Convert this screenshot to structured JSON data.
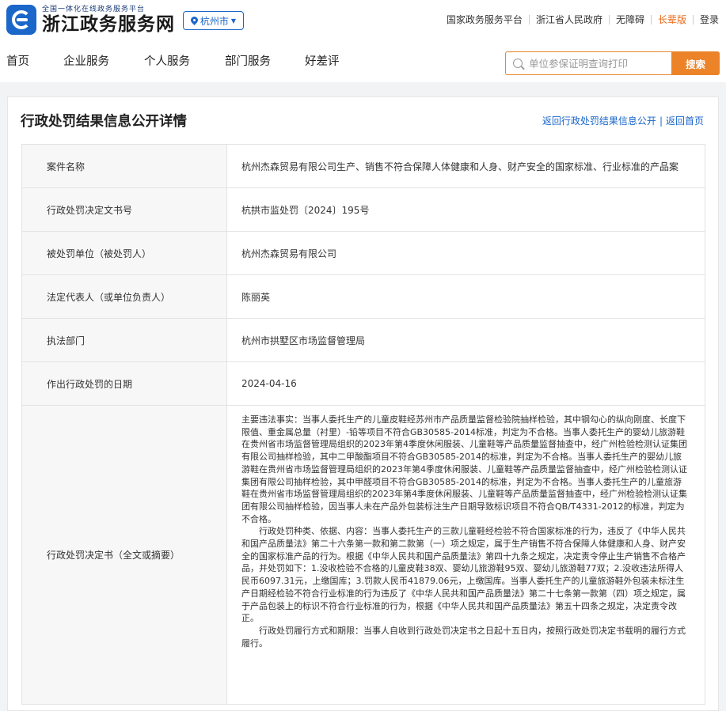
{
  "header": {
    "logo_sub": "全国一体化在线政务服务平台",
    "logo_main": "浙江政务服务网",
    "city": "杭州市",
    "top_links": [
      "国家政务服务平台",
      "浙江省人民政府",
      "无障碍",
      "长辈版",
      "登录"
    ]
  },
  "nav": {
    "items": [
      "首页",
      "企业服务",
      "个人服务",
      "部门服务",
      "好差评"
    ]
  },
  "search": {
    "placeholder": "单位参保证明查询打印",
    "button": "搜索"
  },
  "page": {
    "title": "行政处罚结果信息公开详情",
    "back_list": "返回行政处罚结果信息公开",
    "back_home": "返回首页"
  },
  "rows": [
    {
      "label": "案件名称",
      "value": "杭州杰森贸易有限公司生产、销售不符合保障人体健康和人身、财产安全的国家标准、行业标准的产品案"
    },
    {
      "label": "行政处罚决定文书号",
      "value": "杭拱市监处罚〔2024〕195号"
    },
    {
      "label": "被处罚单位（被处罚人）",
      "value": "杭州杰森贸易有限公司"
    },
    {
      "label": "法定代表人（或单位负责人）",
      "value": "陈丽英"
    },
    {
      "label": "执法部门",
      "value": "杭州市拱墅区市场监督管理局"
    },
    {
      "label": "作出行政处罚的日期",
      "value": "2024-04-16"
    }
  ],
  "decision": {
    "label": "行政处罚决定书（全文或摘要）",
    "para1": "主要违法事实：当事人委托生产的儿童皮鞋经苏州市产品质量监督检验院抽样检验，其中钢勾心的纵向刚度、长度下限值、重金属总量（衬里）-铅等项目不符合GB30585-2014标准，判定为不合格。当事人委托生产的婴幼儿旅游鞋在贵州省市场监督管理局组织的2023年第4季度休闲服装、儿童鞋等产品质量监督抽查中，经广州检验检测认证集团有限公司抽样检验，其中二甲酸酯项目不符合GB30585-2014的标准，判定为不合格。当事人委托生产的婴幼儿旅游鞋在贵州省市场监督管理局组织的2023年第4季度休闲服装、儿童鞋等产品质量监督抽查中，经广州检验检测认证集团有限公司抽样检验，其中甲醛项目不符合GB30585-2014的标准，判定为不合格。当事人委托生产的儿童旅游鞋在贵州省市场监督管理局组织的2023年第4季度休闲服装、儿童鞋等产品质量监督抽查中，经广州检验检测认证集团有限公司抽样检验，因当事人未在产品外包装标注生产日期导致标识项目不符合QB/T4331-2012的标准，判定为不合格。",
    "para2": "行政处罚种类、依据、内容：当事人委托生产的三款儿童鞋经检验不符合国家标准的行为，违反了《中华人民共和国产品质量法》第二十六条第一款和第二款第（一）项之规定，属于生产销售不符合保障人体健康和人身、财产安全的国家标准产品的行为。根据《中华人民共和国产品质量法》第四十九条之规定，决定责令停止生产销售不合格产品，并处罚如下：1.没收检验不合格的儿童皮鞋38双、婴幼儿旅游鞋95双、婴幼儿旅游鞋77双；2.没收违法所得人民币6097.31元，上缴国库；3.罚款人民币41879.06元，上缴国库。当事人委托生产的儿童旅游鞋外包装未标注生产日期经检验不符合行业标准的行为违反了《中华人民共和国产品质量法》第二十七条第一款第（四）项之规定，属于产品包装上的标识不符合行业标准的行为，根据《中华人民共和国产品质量法》第五十四条之规定，决定责令改正。",
    "para3": "行政处罚履行方式和期限：当事人自收到行政处罚决定书之日起十五日内，按照行政处罚决定书载明的履行方式履行。"
  }
}
